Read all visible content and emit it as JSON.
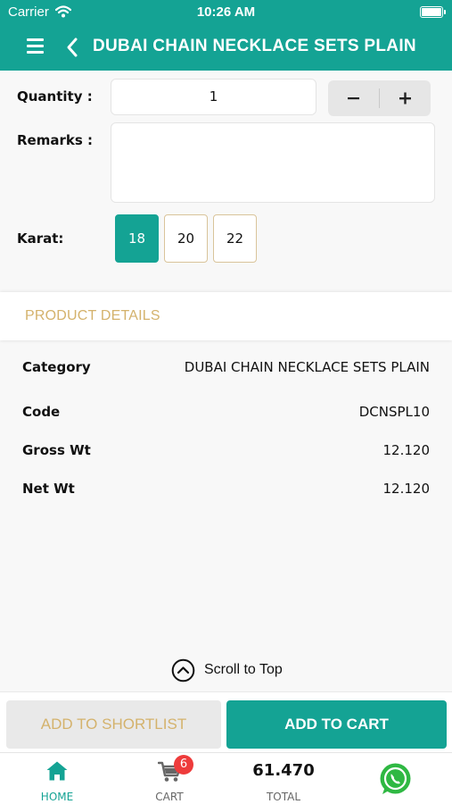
{
  "status_bar": {
    "carrier": "Carrier",
    "time": "10:26 AM"
  },
  "navbar": {
    "title": "DUBAI CHAIN NECKLACE SETS PLAIN"
  },
  "form": {
    "quantity_label": "Quantity :",
    "quantity_value": "1",
    "minus_label": "−",
    "plus_label": "+",
    "remarks_label": "Remarks :",
    "remarks_value": "",
    "karat_label": "Karat:",
    "karat_options": [
      "18",
      "20",
      "22"
    ],
    "karat_selected": "18"
  },
  "details": {
    "header": "PRODUCT DETAILS",
    "rows": [
      {
        "label": "Category",
        "value": "DUBAI CHAIN NECKLACE SETS PLAIN"
      },
      {
        "label": "Code",
        "value": "DCNSPL10"
      },
      {
        "label": "Gross Wt",
        "value": "12.120"
      },
      {
        "label": "Net Wt",
        "value": "12.120"
      }
    ]
  },
  "scroll_to_top": "Scroll to Top",
  "actions": {
    "shortlist": "ADD TO SHORTLIST",
    "cart": "ADD TO CART"
  },
  "tab_bar": {
    "home": "HOME",
    "cart": "CART",
    "cart_count": "6",
    "total_value": "61.470",
    "total_label": "TOTAL"
  },
  "colors": {
    "primary": "#14a394",
    "gold": "#d4b26c",
    "badge": "#ee3b3b",
    "whatsapp": "#2fb843"
  }
}
